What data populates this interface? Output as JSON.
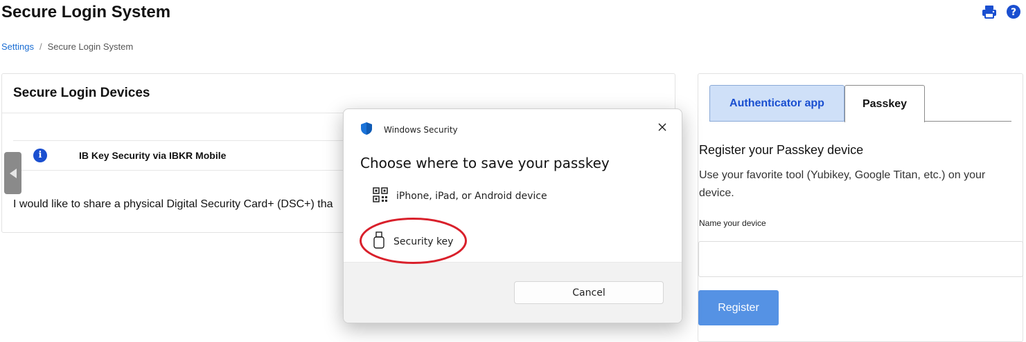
{
  "page": {
    "title": "Secure Login System",
    "icons": [
      "print-icon",
      "help-icon"
    ]
  },
  "breadcrumb": {
    "items": [
      "Settings",
      "Secure Login System"
    ]
  },
  "devices_panel": {
    "title": "Secure Login Devices",
    "row": {
      "icon": "info-icon",
      "name": "IB Key Security via IBKR Mobile"
    },
    "share_text": "I would like to share a physical Digital Security Card+ (DSC+) tha"
  },
  "register_panel": {
    "tabs": [
      {
        "label": "Authenticator app",
        "active": false
      },
      {
        "label": "Passkey",
        "active": true
      }
    ],
    "title": "Register your Passkey device",
    "description": "Use your favorite tool (Yubikey, Google Titan, etc.) on your device.",
    "name_label": "Name your device",
    "name_value": "",
    "register_label": "Register"
  },
  "dialog": {
    "app_name": "Windows Security",
    "heading": "Choose where to save your passkey",
    "options": [
      {
        "label": "iPhone, iPad, or Android device",
        "icon": "qr-code-icon"
      },
      {
        "label": "Security key",
        "icon": "usb-key-icon",
        "highlighted": true
      }
    ],
    "cancel_label": "Cancel"
  },
  "colors": {
    "accent": "#1a4fd0",
    "link": "#1a6dd3",
    "register_button": "#5592e4",
    "tab_active_bg": "#cfe0f8",
    "highlight": "#d9202b"
  }
}
